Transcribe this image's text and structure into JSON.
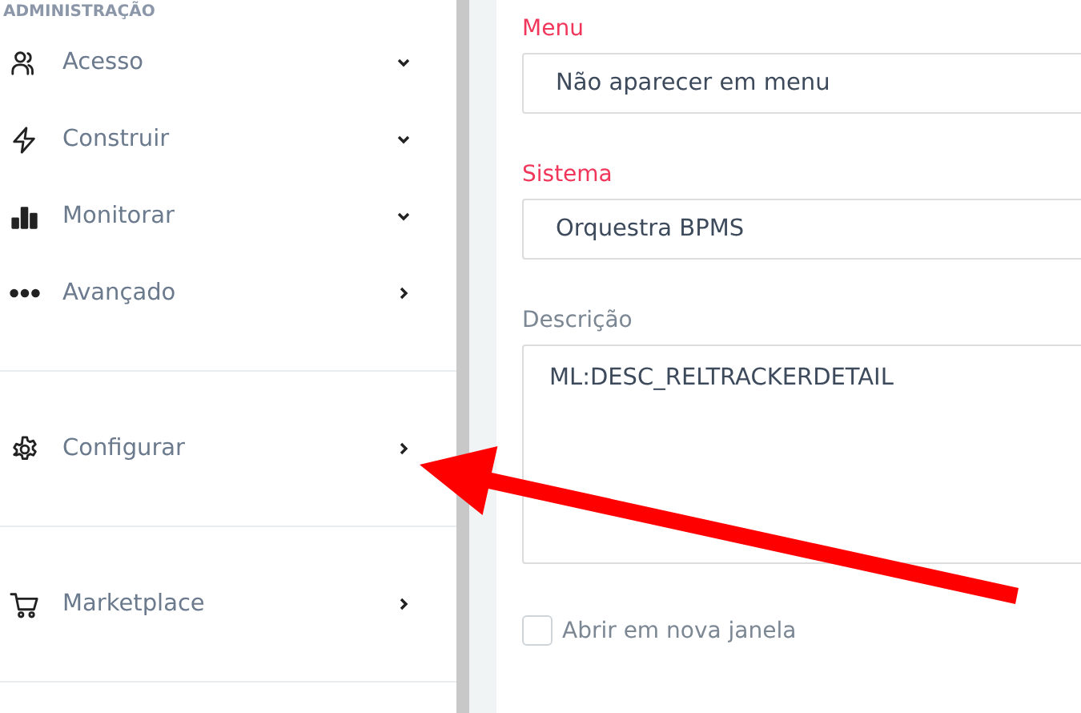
{
  "sidebar": {
    "heading": "ADMINISTRAÇÃO",
    "sections": [
      {
        "items": [
          {
            "label": "Acesso",
            "kind": "dropdown"
          },
          {
            "label": "Construir",
            "kind": "dropdown"
          },
          {
            "label": "Monitorar",
            "kind": "dropdown"
          },
          {
            "label": "Avançado",
            "kind": "link"
          }
        ]
      },
      {
        "items": [
          {
            "label": "Configurar",
            "kind": "link"
          }
        ]
      },
      {
        "items": [
          {
            "label": "Marketplace",
            "kind": "link"
          }
        ]
      }
    ]
  },
  "form": {
    "fields": [
      {
        "label": "Menu",
        "kind": "select",
        "value": "Não aparecer em menu",
        "required": true
      },
      {
        "label": "Sistema",
        "kind": "select",
        "value": "Orquestra BPMS",
        "required": true
      },
      {
        "label": "Descrição",
        "kind": "textarea",
        "value": "ML:DESC_RELTRACKERDETAIL",
        "required": false
      }
    ],
    "checkbox": {
      "label": "Abrir em nova janela",
      "checked": false
    }
  },
  "annotation": {
    "kind": "arrow"
  }
}
